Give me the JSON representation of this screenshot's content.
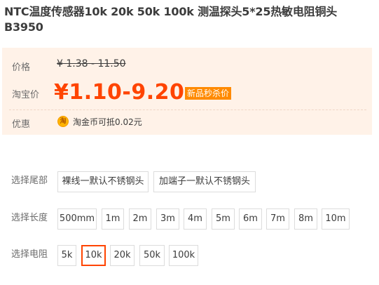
{
  "product": {
    "title": "NTC温度传感器10k 20k 50k 100k 测温探头5*25热敏电阻铜头B3950"
  },
  "price": {
    "label": "价格",
    "value": "¥ 1.38 - 11.50"
  },
  "taobao_price": {
    "label": "淘宝价",
    "value": "¥1.10-9.20",
    "badge": "新品秒杀价"
  },
  "discount": {
    "label": "优惠",
    "coin_icon_glyph": "淘",
    "text": "淘金币可抵0.02元"
  },
  "options": {
    "tail": {
      "label": "选择尾部",
      "items": [
        "裸线一默认不锈钢头",
        "加端子一默认不锈钢头"
      ]
    },
    "length": {
      "label": "选择长度",
      "items": [
        "500mm",
        "1m",
        "2m",
        "3m",
        "4m",
        "5m",
        "6m",
        "7m",
        "8m",
        "10m"
      ]
    },
    "resistance": {
      "label": "选择电阻",
      "items": [
        "5k",
        "10k",
        "20k",
        "50k",
        "100k"
      ],
      "selected": "10k"
    }
  },
  "colors": {
    "accent": "#ff4400",
    "badge": "#ff8a00",
    "panel_bg": "#fff2e8"
  }
}
